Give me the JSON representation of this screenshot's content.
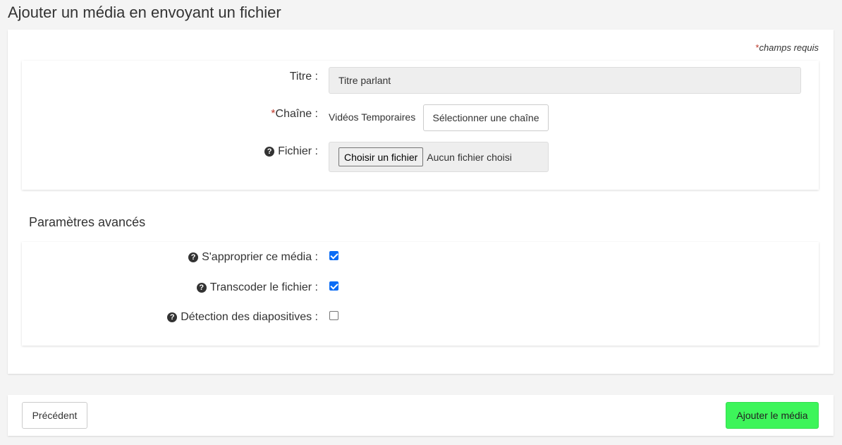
{
  "page": {
    "title": "Ajouter un média en envoyant un fichier"
  },
  "required_note": {
    "star": "*",
    "text": "champs requis"
  },
  "form": {
    "title_label": "Titre :",
    "title_value": "Titre parlant",
    "channel_required_star": "*",
    "channel_label": "Chaîne :",
    "channel_value": "Vidéos Temporaires",
    "select_channel_button": "Sélectionner une chaîne",
    "file_label": "Fichier :",
    "choose_file_button": "Choisir un fichier",
    "no_file_text": "Aucun fichier choisi"
  },
  "advanced": {
    "title": "Paramètres avancés",
    "options": [
      {
        "label": "S'approprier ce média :",
        "checked": true
      },
      {
        "label": "Transcoder le fichier :",
        "checked": true
      },
      {
        "label": "Détection des diapositives :",
        "checked": false
      }
    ]
  },
  "footer": {
    "previous_button": "Précédent",
    "submit_button": "Ajouter le média"
  },
  "colors": {
    "submit_button": "#3df55a",
    "required_star": "#c0392b",
    "checkbox_checked": "#0a6cf5"
  }
}
